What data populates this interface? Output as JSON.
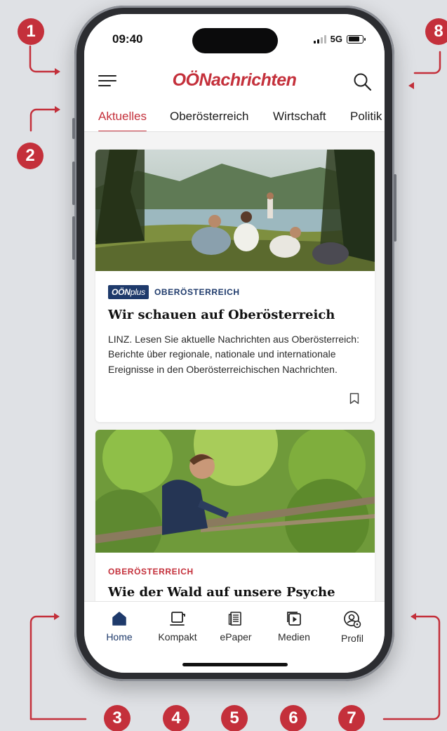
{
  "colors": {
    "brand_red": "#c4303b",
    "navy": "#1e3a6b",
    "badge": "#c4303b"
  },
  "callouts": [
    "1",
    "2",
    "3",
    "4",
    "5",
    "6",
    "7",
    "8"
  ],
  "status_bar": {
    "time": "09:40",
    "network": "5G",
    "battery_level": 0.8
  },
  "header": {
    "logo": "OÖNachrichten",
    "menu_icon": "hamburger-menu-icon",
    "search_icon": "search-icon"
  },
  "tabs": [
    {
      "label": "Aktuelles",
      "active": true
    },
    {
      "label": "Oberösterreich",
      "active": false
    },
    {
      "label": "Wirtschaft",
      "active": false
    },
    {
      "label": "Politik",
      "active": false
    }
  ],
  "articles": [
    {
      "badge": {
        "brand": "OÖN",
        "suffix": "plus"
      },
      "kicker": "OBERÖSTERREICH",
      "title": "Wir schauen auf Oberösterreich",
      "teaser": "LINZ. Lesen Sie aktuelle Nachrichten aus Oberösterreich: Berichte über regionale, nationale und internationale Ereignisse in den Oberösterreichischen Nachrichten.",
      "bookmark_icon": "bookmark-icon"
    },
    {
      "kicker": "OBERÖSTERREICH",
      "title": "Wie der Wald auf unsere Psyche wirkt"
    }
  ],
  "bottom_nav": [
    {
      "label": "Home",
      "icon": "home-icon",
      "active": true
    },
    {
      "label": "Kompakt",
      "icon": "kompakt-icon",
      "active": false
    },
    {
      "label": "ePaper",
      "icon": "epaper-icon",
      "active": false
    },
    {
      "label": "Medien",
      "icon": "media-play-icon",
      "active": false
    },
    {
      "label": "Profil",
      "icon": "profile-settings-icon",
      "active": false
    }
  ]
}
